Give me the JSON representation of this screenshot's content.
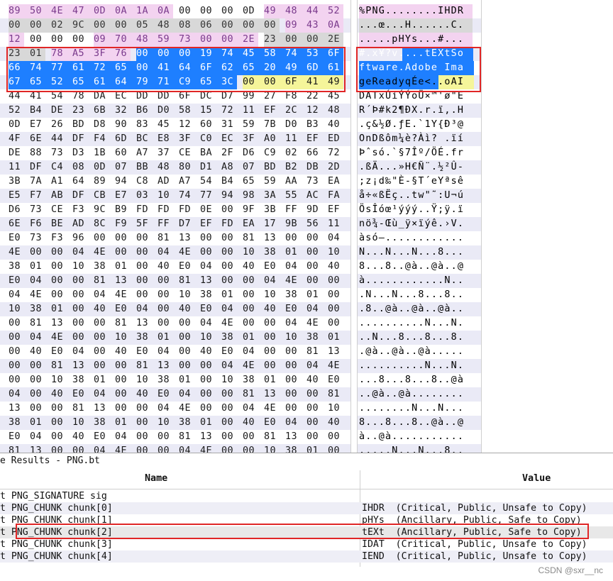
{
  "hex_view": {
    "rows": [
      {
        "hex": [
          "89",
          "50",
          "4E",
          "47",
          "0D",
          "0A",
          "1A",
          "0A",
          "00",
          "00",
          "00",
          "0D",
          "49",
          "48",
          "44",
          "52"
        ],
        "ascii": "%PNG........IHDR"
      },
      {
        "hex": [
          "00",
          "00",
          "02",
          "9C",
          "00",
          "00",
          "05",
          "48",
          "08",
          "06",
          "00",
          "00",
          "00",
          "09",
          "43",
          "0A"
        ],
        "ascii": "...œ...H......C."
      },
      {
        "hex": [
          "12",
          "00",
          "00",
          "00",
          "09",
          "70",
          "48",
          "59",
          "73",
          "00",
          "00",
          "2E",
          "23",
          "00",
          "00",
          "2E"
        ],
        "ascii": ".....pHYs...#..."
      },
      {
        "hex": [
          "23",
          "01",
          "78",
          "A5",
          "3F",
          "76",
          "00",
          "00",
          "00",
          "19",
          "74",
          "45",
          "58",
          "74",
          "53",
          "6F"
        ],
        "ascii": "#.x¥?v....tEXtSo"
      },
      {
        "hex": [
          "66",
          "74",
          "77",
          "61",
          "72",
          "65",
          "00",
          "41",
          "64",
          "6F",
          "62",
          "65",
          "20",
          "49",
          "6D",
          "61"
        ],
        "ascii": "ftware.Adobe Ima"
      },
      {
        "hex": [
          "67",
          "65",
          "52",
          "65",
          "61",
          "64",
          "79",
          "71",
          "C9",
          "65",
          "3C",
          "00",
          "00",
          "6F",
          "41",
          "49"
        ],
        "ascii": "geReadyqÉe<..oAI"
      },
      {
        "hex": [
          "44",
          "41",
          "54",
          "78",
          "DA",
          "EC",
          "DD",
          "DD",
          "6F",
          "DC",
          "D7",
          "99",
          "27",
          "F8",
          "22",
          "45"
        ],
        "ascii": "DATxÚìÝÝoÜ×™'ø\"E"
      },
      {
        "hex": [
          "52",
          "B4",
          "DE",
          "23",
          "6B",
          "32",
          "B6",
          "D0",
          "58",
          "15",
          "72",
          "11",
          "EF",
          "2C",
          "12",
          "48"
        ],
        "ascii": "R´Þ#k2¶ÐX.r.ï,.H"
      },
      {
        "hex": [
          "0D",
          "E7",
          "26",
          "BD",
          "D8",
          "90",
          "83",
          "45",
          "12",
          "60",
          "31",
          "59",
          "7B",
          "D0",
          "B3",
          "40"
        ],
        "ascii": ".ç&½Ø.ƒE.`1Y{Ð³@"
      },
      {
        "hex": [
          "4F",
          "6E",
          "44",
          "DF",
          "F4",
          "6D",
          "BC",
          "E8",
          "3F",
          "C0",
          "EC",
          "3F",
          "A0",
          "11",
          "EF",
          "ED"
        ],
        "ascii": "OnDßôm¼è?Àì? .ïí"
      },
      {
        "hex": [
          "DE",
          "88",
          "73",
          "D3",
          "1B",
          "60",
          "A7",
          "37",
          "CE",
          "BA",
          "2F",
          "D6",
          "C9",
          "02",
          "66",
          "72"
        ],
        "ascii": "Þˆsó.`§7Îº/ÖÉ.fr"
      },
      {
        "hex": [
          "11",
          "DF",
          "C4",
          "08",
          "0D",
          "07",
          "BB",
          "48",
          "80",
          "D1",
          "A8",
          "07",
          "BD",
          "B2",
          "DB",
          "2D"
        ],
        "ascii": ".ßÄ...»H€Ñ¨.½²Û-"
      },
      {
        "hex": [
          "3B",
          "7A",
          "A1",
          "64",
          "89",
          "94",
          "C8",
          "AD",
          "A7",
          "54",
          "B4",
          "65",
          "59",
          "AA",
          "73",
          "EA"
        ],
        "ascii": ";z¡d‰\"È-§T´eYªsê"
      },
      {
        "hex": [
          "E5",
          "F7",
          "AB",
          "DF",
          "CB",
          "E7",
          "03",
          "10",
          "74",
          "77",
          "94",
          "98",
          "3A",
          "55",
          "AC",
          "FA"
        ],
        "ascii": "å÷«ßËç..tw\"˜:U¬ú"
      },
      {
        "hex": [
          "D6",
          "73",
          "CE",
          "F3",
          "9C",
          "B9",
          "FD",
          "FD",
          "FD",
          "0E",
          "00",
          "9F",
          "3B",
          "FF",
          "9D",
          "EF"
        ],
        "ascii": "ÖsÎóœ¹ýýý..Ÿ;ÿ.ï"
      },
      {
        "hex": [
          "6E",
          "F6",
          "BE",
          "AD",
          "8C",
          "F9",
          "5F",
          "FF",
          "D7",
          "EF",
          "FD",
          "EA",
          "17",
          "9B",
          "56",
          "11"
        ],
        "ascii": "nö¾-Œù_ÿ×ïýê.›V."
      },
      {
        "hex": [
          "E0",
          "73",
          "F3",
          "96",
          "00",
          "00",
          "00",
          "81",
          "13",
          "00",
          "00",
          "81",
          "13",
          "00",
          "00",
          "04"
        ],
        "ascii": "àsó–............"
      },
      {
        "hex": [
          "4E",
          "00",
          "00",
          "04",
          "4E",
          "00",
          "00",
          "04",
          "4E",
          "00",
          "00",
          "10",
          "38",
          "01",
          "00",
          "10"
        ],
        "ascii": "N...N...N...8..."
      },
      {
        "hex": [
          "38",
          "01",
          "00",
          "10",
          "38",
          "01",
          "00",
          "40",
          "E0",
          "04",
          "00",
          "40",
          "E0",
          "04",
          "00",
          "40"
        ],
        "ascii": "8...8..@à..@à..@"
      },
      {
        "hex": [
          "E0",
          "04",
          "00",
          "00",
          "81",
          "13",
          "00",
          "00",
          "81",
          "13",
          "00",
          "00",
          "04",
          "4E",
          "00",
          "00"
        ],
        "ascii": "à............N.."
      },
      {
        "hex": [
          "04",
          "4E",
          "00",
          "00",
          "04",
          "4E",
          "00",
          "00",
          "10",
          "38",
          "01",
          "00",
          "10",
          "38",
          "01",
          "00"
        ],
        "ascii": ".N...N...8...8.."
      },
      {
        "hex": [
          "10",
          "38",
          "01",
          "00",
          "40",
          "E0",
          "04",
          "00",
          "40",
          "E0",
          "04",
          "00",
          "40",
          "E0",
          "04",
          "00"
        ],
        "ascii": ".8..@à..@à..@à.."
      },
      {
        "hex": [
          "00",
          "81",
          "13",
          "00",
          "00",
          "81",
          "13",
          "00",
          "00",
          "04",
          "4E",
          "00",
          "00",
          "04",
          "4E",
          "00"
        ],
        "ascii": "..........N...N."
      },
      {
        "hex": [
          "00",
          "04",
          "4E",
          "00",
          "00",
          "10",
          "38",
          "01",
          "00",
          "10",
          "38",
          "01",
          "00",
          "10",
          "38",
          "01"
        ],
        "ascii": "..N...8...8...8."
      },
      {
        "hex": [
          "00",
          "40",
          "E0",
          "04",
          "00",
          "40",
          "E0",
          "04",
          "00",
          "40",
          "E0",
          "04",
          "00",
          "00",
          "81",
          "13"
        ],
        "ascii": ".@à..@à..@à....."
      },
      {
        "hex": [
          "00",
          "00",
          "81",
          "13",
          "00",
          "00",
          "81",
          "13",
          "00",
          "00",
          "04",
          "4E",
          "00",
          "00",
          "04",
          "4E"
        ],
        "ascii": "..........N...N."
      },
      {
        "hex": [
          "00",
          "00",
          "10",
          "38",
          "01",
          "00",
          "10",
          "38",
          "01",
          "00",
          "10",
          "38",
          "01",
          "00",
          "40",
          "E0"
        ],
        "ascii": "...8...8...8..@à"
      },
      {
        "hex": [
          "04",
          "00",
          "40",
          "E0",
          "04",
          "00",
          "40",
          "E0",
          "04",
          "00",
          "00",
          "81",
          "13",
          "00",
          "00",
          "81"
        ],
        "ascii": "..@à..@à........"
      },
      {
        "hex": [
          "13",
          "00",
          "00",
          "81",
          "13",
          "00",
          "00",
          "04",
          "4E",
          "00",
          "00",
          "04",
          "4E",
          "00",
          "00",
          "10"
        ],
        "ascii": "........N...N..."
      },
      {
        "hex": [
          "38",
          "01",
          "00",
          "10",
          "38",
          "01",
          "00",
          "10",
          "38",
          "01",
          "00",
          "40",
          "E0",
          "04",
          "00",
          "40"
        ],
        "ascii": "8...8...8..@à..@"
      },
      {
        "hex": [
          "E0",
          "04",
          "00",
          "40",
          "E0",
          "04",
          "00",
          "00",
          "81",
          "13",
          "00",
          "00",
          "81",
          "13",
          "00",
          "00"
        ],
        "ascii": "à..@à..........."
      },
      {
        "hex": [
          "81",
          "13",
          "00",
          "00",
          "04",
          "4E",
          "00",
          "00",
          "04",
          "4E",
          "00",
          "00",
          "10",
          "38",
          "01",
          "00"
        ],
        "ascii": ".....N...N...8.."
      }
    ]
  },
  "results": {
    "title": "e Results - PNG.bt",
    "col_name": "Name",
    "col_value": "Value",
    "rows": [
      {
        "name": "t PNG_SIGNATURE sig",
        "value": ""
      },
      {
        "name": "t PNG_CHUNK chunk[0]",
        "value": "IHDR  (Critical, Public, Unsafe to Copy)"
      },
      {
        "name": "t PNG_CHUNK chunk[1]",
        "value": "pHYs  (Ancillary, Public, Safe to Copy)"
      },
      {
        "name": "t PNG_CHUNK chunk[2]",
        "value": "tEXt  (Ancillary, Public, Safe to Copy)"
      },
      {
        "name": "t PNG_CHUNK chunk[3]",
        "value": "IDAT  (Critical, Public, Unsafe to Copy)"
      },
      {
        "name": "t PNG_CHUNK chunk[4]",
        "value": "IEND  (Critical, Public, Unsafe to Copy)"
      }
    ]
  },
  "watermark": "CSDN @sxr__nc",
  "colors": {
    "selection_blue": "#1e7fff",
    "highlight_yellow": "#f5f59a",
    "highlight_pink": "#f3d3f0",
    "highlight_gray": "#d8d8d8",
    "annotation_red": "#e02626"
  }
}
